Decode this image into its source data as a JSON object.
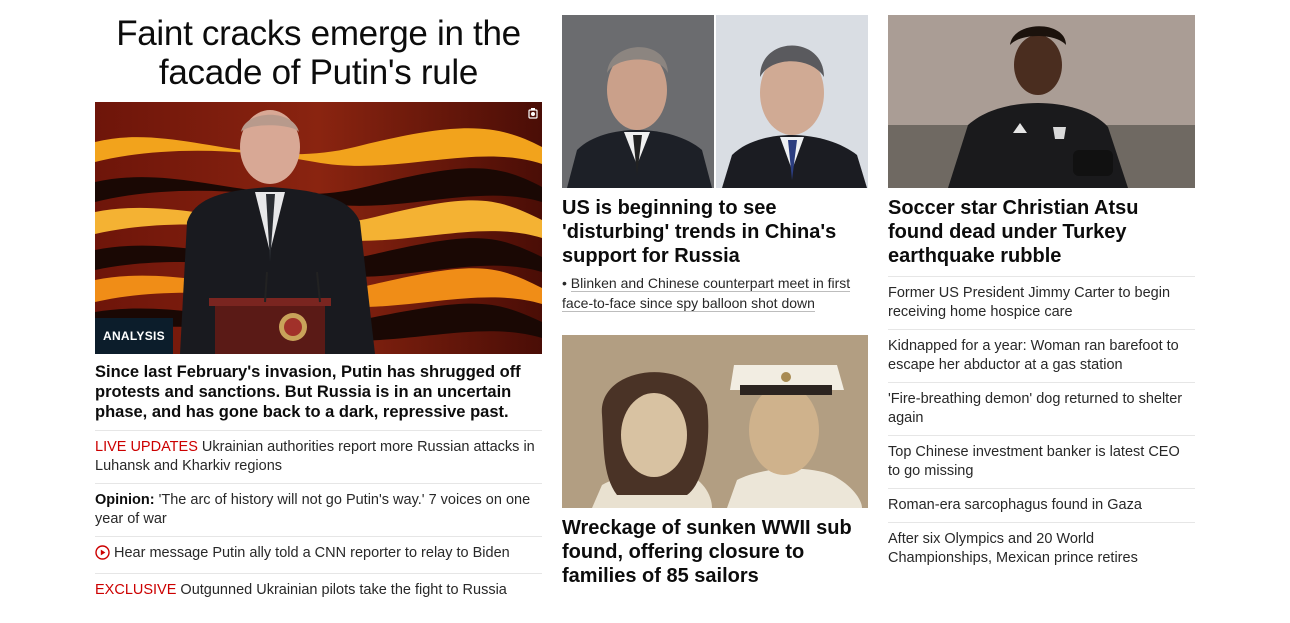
{
  "lead": {
    "title": "Faint cracks emerge in the facade of Putin's rule",
    "badge": "ANALYSIS",
    "image_icon": "camera-icon",
    "summary": "Since last February's invasion, Putin has shrugged off protests and sanctions. But Russia is in an uncertain phase, and has gone back to a dark, repressive past.",
    "links": [
      {
        "kicker": "LIVE UPDATES",
        "text": " Ukrainian authorities report more Russian attacks in Luhansk and Kharkiv regions"
      },
      {
        "kicker": "Opinion:",
        "text": " 'The arc of history will not go Putin's way.' 7 voices on one year of war"
      },
      {
        "icon": "play-circle-icon",
        "text": "Hear message Putin ally told a CNN reporter to relay to Biden"
      },
      {
        "kicker": "EXCLUSIVE",
        "text": " Outgunned Ukrainian pilots take the fight to Russia"
      }
    ]
  },
  "middle": {
    "story1": {
      "headline": "US is beginning to see 'disturbing' trends in China's support for Russia",
      "bullet": "Blinken and Chinese counterpart meet in first face-to-face since spy balloon shot down"
    },
    "story2": {
      "headline": "Wreckage of sunken WWII sub found, offering closure to families of 85 sailors"
    }
  },
  "right": {
    "headline": "Soccer star Christian Atsu found dead under Turkey earthquake rubble",
    "links": [
      "Former US President Jimmy Carter to begin receiving home hospice care",
      "Kidnapped for a year: Woman ran barefoot to escape her abductor at a gas station",
      "'Fire-breathing demon' dog returned to shelter again",
      "Top Chinese investment banker is latest CEO to go missing",
      "Roman-era sarcophagus found in Gaza",
      "After six Olympics and 20 World Championships, Mexican prince retires"
    ]
  },
  "colors": {
    "kicker_red": "#cc0000",
    "badge_bg": "#0c1d2b",
    "text": "#0c0c0c",
    "divider": "#e6e6e6"
  }
}
